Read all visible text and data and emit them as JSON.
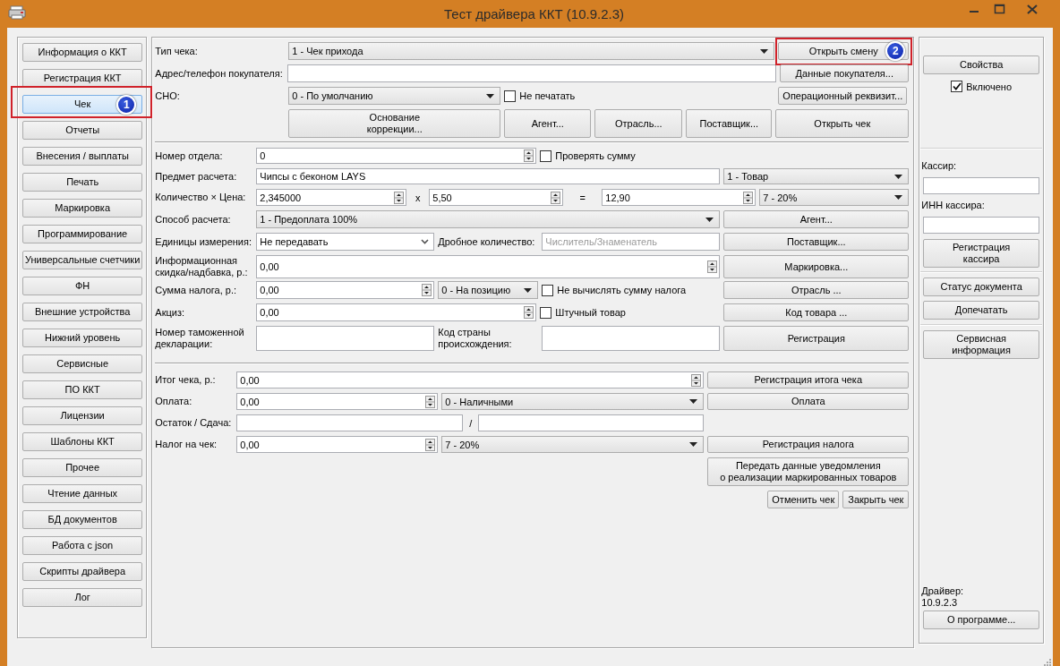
{
  "window": {
    "title": "Тест драйвера ККТ (10.9.2.3)"
  },
  "nav": {
    "items": [
      {
        "label": "Информация о ККТ",
        "selected": false
      },
      {
        "label": "Регистрация ККТ",
        "selected": false
      },
      {
        "label": "Чек",
        "selected": true,
        "callout": "1"
      },
      {
        "label": "Отчеты",
        "selected": false
      },
      {
        "label": "Внесения / выплаты",
        "selected": false
      },
      {
        "label": "Печать",
        "selected": false
      },
      {
        "label": "Маркировка",
        "selected": false
      },
      {
        "label": "Программирование",
        "selected": false
      },
      {
        "label": "Универсальные счетчики",
        "selected": false
      },
      {
        "label": "ФН",
        "selected": false
      },
      {
        "label": "Внешние устройства",
        "selected": false
      },
      {
        "label": "Нижний уровень",
        "selected": false
      },
      {
        "label": "Сервисные",
        "selected": false
      },
      {
        "label": "ПО ККТ",
        "selected": false
      },
      {
        "label": "Лицензии",
        "selected": false
      },
      {
        "label": "Шаблоны ККТ",
        "selected": false
      },
      {
        "label": "Прочее",
        "selected": false
      },
      {
        "label": "Чтение данных",
        "selected": false
      },
      {
        "label": "БД документов",
        "selected": false
      },
      {
        "label": "Работа с json",
        "selected": false
      },
      {
        "label": "Скрипты драйвера",
        "selected": false
      },
      {
        "label": "Лог",
        "selected": false
      }
    ]
  },
  "receipt_header": {
    "lines": [
      {
        "controls": [
          {
            "kind": "label",
            "text": "Тип чека:"
          },
          {
            "kind": "combo",
            "value": "1 - Чек прихода"
          },
          {
            "kind": "button",
            "label": "Открыть смену",
            "callout": "2"
          }
        ]
      },
      {
        "controls": [
          {
            "kind": "label",
            "text": "Адрес/телефон покупателя:"
          },
          {
            "kind": "input"
          },
          {
            "kind": "button",
            "label": "Данные покупателя..."
          }
        ]
      },
      {
        "controls": [
          {
            "kind": "label",
            "text": "СНО:"
          },
          {
            "kind": "combo",
            "value": "0 - По умолчанию"
          },
          {
            "kind": "checkbox",
            "label": "Не печатать",
            "checked": false
          },
          {
            "kind": "button",
            "label": "Операционный реквизит..."
          }
        ]
      },
      {
        "controls": [
          {
            "kind": "button",
            "label": "Основание\nкоррекции..."
          },
          {
            "kind": "button",
            "label": "Агент..."
          },
          {
            "kind": "button",
            "label": "Отрасль..."
          },
          {
            "kind": "button",
            "label": "Поставщик..."
          },
          {
            "kind": "button",
            "label": "Открыть чек"
          }
        ]
      }
    ]
  },
  "item_section": {
    "lines": [
      {
        "controls": [
          {
            "kind": "label",
            "text": "Номер отдела:"
          },
          {
            "kind": "spin",
            "value": "0"
          },
          {
            "kind": "checkbox",
            "label": "Проверять сумму",
            "checked": false
          }
        ]
      },
      {
        "controls": [
          {
            "kind": "label",
            "text": "Предмет расчета:"
          },
          {
            "kind": "input",
            "value": "Чипсы с беконом LAYS"
          },
          {
            "kind": "combo",
            "value": "1 - Товар"
          }
        ]
      },
      {
        "controls": [
          {
            "kind": "label",
            "text": "Количество × Цена:"
          },
          {
            "kind": "spin",
            "value": "2,345000"
          },
          {
            "kind": "sign",
            "text": "x"
          },
          {
            "kind": "spin",
            "value": "5,50"
          },
          {
            "kind": "sign",
            "text": "="
          },
          {
            "kind": "spin",
            "value": "12,90"
          },
          {
            "kind": "combo",
            "value": "7 - 20%"
          }
        ]
      },
      {
        "controls": [
          {
            "kind": "label",
            "text": "Способ расчета:"
          },
          {
            "kind": "combo",
            "value": "1 - Предоплата 100%"
          },
          {
            "kind": "button",
            "label": "Агент..."
          }
        ]
      },
      {
        "controls": [
          {
            "kind": "label",
            "text": "Единицы измерения:"
          },
          {
            "kind": "list",
            "value": "Не передавать"
          },
          {
            "kind": "label",
            "text": "Дробное количество:"
          },
          {
            "kind": "input",
            "placeholder": "Числитель/Знаменатель"
          },
          {
            "kind": "button",
            "label": "Поставщик..."
          }
        ]
      },
      {
        "controls": [
          {
            "kind": "label",
            "text": "Информационная скидка/надбавка, р.:"
          },
          {
            "kind": "spin",
            "value": "0,00"
          },
          {
            "kind": "button",
            "label": "Маркировка..."
          }
        ]
      },
      {
        "controls": [
          {
            "kind": "label",
            "text": "Сумма налога, р.:"
          },
          {
            "kind": "spin",
            "value": "0,00"
          },
          {
            "kind": "combo",
            "value": "0 - На позицию"
          },
          {
            "kind": "checkbox",
            "label": "Не вычислять сумму налога",
            "checked": false
          },
          {
            "kind": "button",
            "label": "Отрасль ..."
          }
        ]
      },
      {
        "controls": [
          {
            "kind": "label",
            "text": "Акциз:"
          },
          {
            "kind": "spin",
            "value": "0,00"
          },
          {
            "kind": "checkbox",
            "label": "Штучный товар",
            "checked": false
          },
          {
            "kind": "button",
            "label": "Код товара ..."
          }
        ]
      },
      {
        "controls": [
          {
            "kind": "label",
            "text": "Номер таможенной декларации:"
          },
          {
            "kind": "input"
          },
          {
            "kind": "label",
            "text": "Код страны происхождения:"
          },
          {
            "kind": "input"
          },
          {
            "kind": "button",
            "label": "Регистрация"
          }
        ]
      }
    ]
  },
  "totals_section": {
    "lines": [
      {
        "controls": [
          {
            "kind": "label",
            "text": "Итог чека, р.:"
          },
          {
            "kind": "spin",
            "value": "0,00"
          },
          {
            "kind": "button",
            "label": "Регистрация итога чека"
          }
        ]
      },
      {
        "controls": [
          {
            "kind": "label",
            "text": "Оплата:"
          },
          {
            "kind": "spin",
            "value": "0,00"
          },
          {
            "kind": "combo",
            "value": "0 - Наличными"
          },
          {
            "kind": "button",
            "label": "Оплата"
          }
        ]
      },
      {
        "controls": [
          {
            "kind": "label",
            "text": "Остаток / Сдача:"
          },
          {
            "kind": "input"
          },
          {
            "kind": "sign",
            "text": "/"
          },
          {
            "kind": "input"
          }
        ]
      },
      {
        "controls": [
          {
            "kind": "label",
            "text": "Налог на чек:"
          },
          {
            "kind": "spin",
            "value": "0,00"
          },
          {
            "kind": "combo",
            "value": "7 - 20%"
          },
          {
            "kind": "button",
            "label": "Регистрация налога"
          }
        ]
      },
      {
        "controls": [
          {
            "kind": "button",
            "label": "Передать данные уведомления\nо реализации маркированных товаров"
          }
        ]
      },
      {
        "controls": [
          {
            "kind": "button",
            "label": "Отменить чек"
          },
          {
            "kind": "button",
            "label": "Закрыть чек"
          }
        ]
      }
    ]
  },
  "right_panel": {
    "groups": [
      {
        "controls": [
          {
            "kind": "button",
            "label": "Свойства"
          },
          {
            "kind": "checkbox",
            "label": "Включено",
            "checked": true
          }
        ]
      },
      {
        "controls": [
          {
            "kind": "label",
            "text": "Кассир:"
          },
          {
            "kind": "input"
          },
          {
            "kind": "label",
            "text": "ИНН кассира:"
          },
          {
            "kind": "input"
          },
          {
            "kind": "button",
            "label": "Регистрация\nкассира"
          }
        ]
      },
      {
        "controls": [
          {
            "kind": "button",
            "label": "Статус документа"
          },
          {
            "kind": "button",
            "label": "Допечатать"
          }
        ]
      },
      {
        "controls": [
          {
            "kind": "button",
            "label": "Сервисная\nинформация"
          }
        ]
      },
      {
        "controls": [
          {
            "kind": "label",
            "text": "Драйвер:"
          },
          {
            "kind": "label",
            "text": "10.9.2.3"
          },
          {
            "kind": "button",
            "label": "О программе..."
          }
        ]
      }
    ]
  }
}
